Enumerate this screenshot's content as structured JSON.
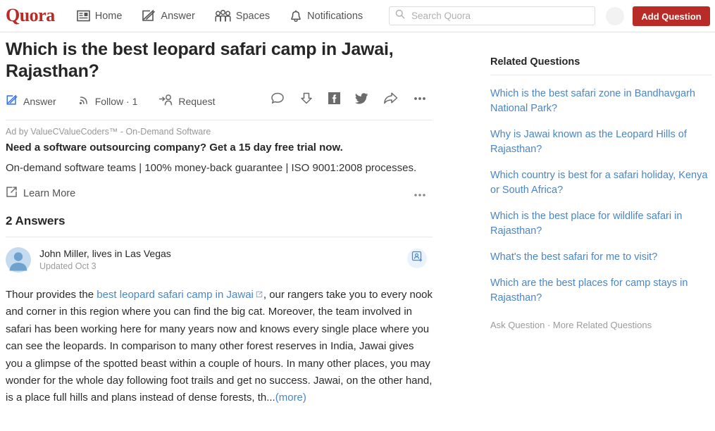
{
  "brand": {
    "logo": "Quora",
    "color": "#b92b27"
  },
  "header": {
    "nav": [
      {
        "label": "Home",
        "icon": "home-icon"
      },
      {
        "label": "Answer",
        "icon": "answer-pencil-icon"
      },
      {
        "label": "Spaces",
        "icon": "spaces-people-icon"
      },
      {
        "label": "Notifications",
        "icon": "bell-icon"
      }
    ],
    "search": {
      "placeholder": "Search Quora",
      "value": "",
      "icon": "search-icon"
    },
    "add_question_label": "Add Question"
  },
  "question": {
    "title": "Which is the best leopard safari camp in Jawai, Rajasthan?",
    "actions": [
      {
        "label": "Answer",
        "icon": "pencil-square-icon"
      },
      {
        "label": "Follow · 1",
        "icon": "rss-follow-icon"
      },
      {
        "label": "Request",
        "icon": "request-person-icon"
      }
    ],
    "social": [
      {
        "name": "comment-icon"
      },
      {
        "name": "downvote-icon"
      },
      {
        "name": "facebook-icon"
      },
      {
        "name": "twitter-icon"
      },
      {
        "name": "share-icon"
      },
      {
        "name": "more-options-icon"
      }
    ]
  },
  "ad": {
    "byline": "Ad by ValueCValueCoders™ - On-Demand Software",
    "headline": "Need a software outsourcing company? Get a 15 day free trial now.",
    "body": "On-demand software teams | 100% money-back guarantee | ISO 9001:2008 processes.",
    "cta_label": "Learn More",
    "cta_icon": "external-link-icon",
    "more_icon": "more-options-icon"
  },
  "answers": {
    "heading": "2 Answers",
    "items": [
      {
        "author": "John Miller, lives in Las Vegas",
        "meta": "Updated Oct 3",
        "avatar_icon": "user-avatar-icon",
        "follow_icon": "add-person-card-icon",
        "text_before_link": "Thour provides the ",
        "link_text": "best leopard safari camp in Jawai",
        "link_icon": "external-link-small-icon",
        "text_after_link": ", our rangers take you to every nook and corner in this region where you can find the big cat. Moreover, the team involved in safari has been working here for many years now and knows every single place where you can see the leopards. In comparison to many other forest reserves in India, Jawai gives you a glimpse of the spotted beast within a couple of hours. In many other places, you may wonder for the whole day following foot trails and get no success. Jawai, on the other hand, is a place full hills and plans instead of dense forests, th...",
        "more_label": "(more)"
      }
    ]
  },
  "sidebar": {
    "title": "Related Questions",
    "questions": [
      "Which is the best safari zone in Bandhavgarh National Park?",
      "Why is Jawai known as the Leopard Hills of Rajasthan?",
      "Which country is best for a safari holiday, Kenya or South Africa?",
      "Which is the best place for wildlife safari in Rajasthan?",
      "What's the best safari for me to visit?",
      "Which are the best places for camp stays in Rajasthan?"
    ],
    "footer_ask": "Ask Question",
    "footer_sep": " · ",
    "footer_more": "More Related Questions"
  }
}
